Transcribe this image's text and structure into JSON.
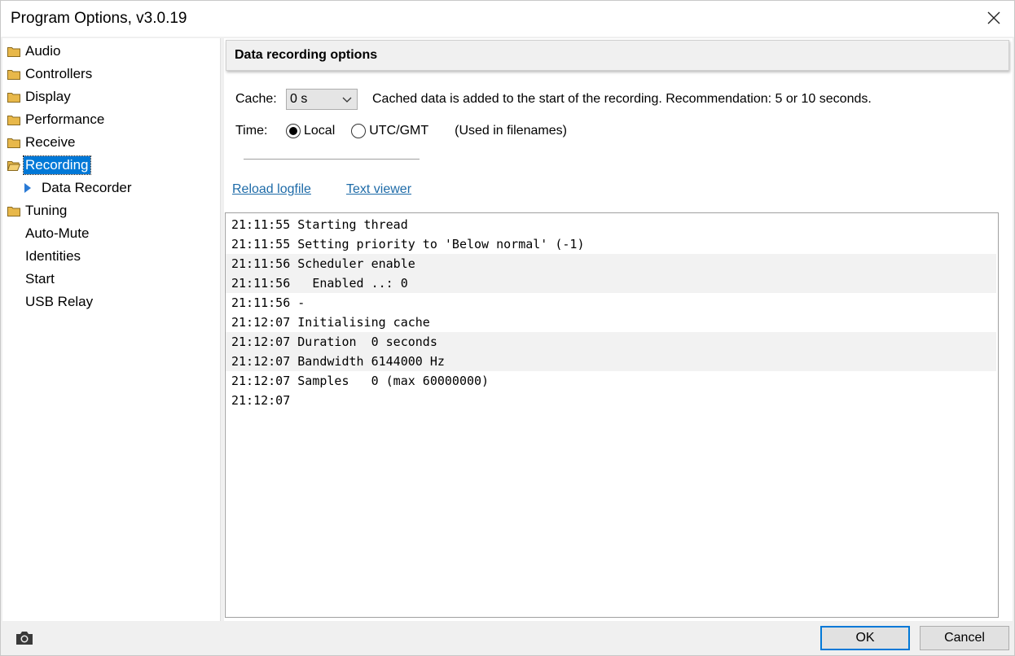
{
  "window": {
    "title": "Program Options, v3.0.19"
  },
  "sidebar": {
    "items": [
      {
        "label": "Audio",
        "icon": "folder-icon"
      },
      {
        "label": "Controllers",
        "icon": "folder-icon"
      },
      {
        "label": "Display",
        "icon": "folder-icon"
      },
      {
        "label": "Performance",
        "icon": "folder-icon"
      },
      {
        "label": "Receive",
        "icon": "folder-icon"
      },
      {
        "label": "Recording",
        "icon": "folder-open-icon",
        "selected": true
      },
      {
        "label": "Data Recorder",
        "icon": "triangle-right-icon",
        "child": true
      },
      {
        "label": "Tuning",
        "icon": "folder-icon"
      },
      {
        "label": "Auto-Mute"
      },
      {
        "label": "Identities"
      },
      {
        "label": "Start"
      },
      {
        "label": "USB Relay"
      }
    ]
  },
  "main": {
    "header_title": "Data recording options",
    "cache": {
      "label": "Cache:",
      "value": "0 s",
      "hint": "Cached data is added to the start of the recording. Recommendation: 5 or 10 seconds."
    },
    "time": {
      "label": "Time:",
      "options": [
        {
          "label": "Local",
          "selected": true
        },
        {
          "label": "UTC/GMT",
          "selected": false
        }
      ],
      "note": "(Used in filenames)"
    },
    "links": {
      "reload": "Reload logfile",
      "viewer": "Text viewer"
    },
    "log_lines": [
      "21:11:55 Starting thread",
      "21:11:55 Setting priority to 'Below normal' (-1)",
      "21:11:56 Scheduler enable",
      "21:11:56   Enabled ..: 0",
      "21:11:56 -",
      "21:12:07 Initialising cache",
      "21:12:07 Duration  0 seconds",
      "21:12:07 Bandwidth 6144000 Hz",
      "21:12:07 Samples   0 (max 60000000)",
      "21:12:07"
    ]
  },
  "footer": {
    "ok_label": "OK",
    "cancel_label": "Cancel"
  },
  "colors": {
    "selection": "#0078d7",
    "link": "#1e6ba8",
    "folder": "#e8b84a"
  }
}
